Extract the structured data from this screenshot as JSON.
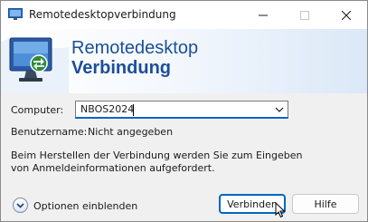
{
  "window": {
    "title": "Remotedesktopverbindung"
  },
  "titlebar": {
    "minimize_icon": "minimize-icon",
    "maximize_icon": "maximize-icon",
    "close_icon": "close-icon"
  },
  "banner": {
    "line1": "Remotedesktop",
    "line2": "Verbindung",
    "icon": "monitor-connection-icon"
  },
  "form": {
    "computer_label": "Computer:",
    "computer_value": "NBOS2024",
    "username_label": "Benutzername:",
    "username_value": "Nicht angegeben",
    "info_line1": "Beim Herstellen der Verbindung werden Sie zum Eingeben",
    "info_line2": "von Anmeldeinformationen aufgefordert."
  },
  "footer": {
    "options_label": "Optionen einblenden",
    "connect_label": "Verbinden",
    "help_label": "Hilfe"
  },
  "colors": {
    "accent": "#0067c0",
    "banner_text": "#1b4f99",
    "background": "#f0f0f0"
  }
}
